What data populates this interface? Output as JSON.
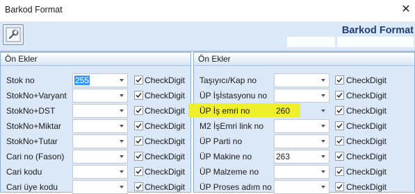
{
  "window": {
    "title": "Barkod Format",
    "close_icon": "close-icon"
  },
  "toolbar": {
    "tool_icon": "wrench-icon"
  },
  "header": {
    "title": "Barkod Format"
  },
  "highlight_color": "#efef2a",
  "selection_color": "#3399ff",
  "left_panel": {
    "title": "Ön Ekler",
    "rows": [
      {
        "label": "Stok no",
        "value": "255",
        "check_label": "CheckDigit",
        "checked": true,
        "selected": true
      },
      {
        "label": "StokNo+Varyant",
        "value": "",
        "check_label": "CheckDigit",
        "checked": true
      },
      {
        "label": "StokNo+DST",
        "value": "",
        "check_label": "CheckDigit",
        "checked": true
      },
      {
        "label": "StokNo+Miktar",
        "value": "",
        "check_label": "CheckDigit",
        "checked": true
      },
      {
        "label": "StokNo+Tutar",
        "value": "",
        "check_label": "CheckDigit",
        "checked": true
      },
      {
        "label": "Cari no (Fason)",
        "value": "",
        "check_label": "CheckDigit",
        "checked": true
      },
      {
        "label": "Cari kodu",
        "value": "",
        "check_label": "CheckDigit",
        "checked": true
      },
      {
        "label": "Cari üye kodu",
        "value": "",
        "check_label": "CheckDigit",
        "checked": true
      }
    ]
  },
  "right_panel": {
    "title": "Ön Ekler",
    "rows": [
      {
        "label": "Taşıyıcı/Kap no",
        "value": "",
        "check_label": "CheckDigit",
        "checked": true
      },
      {
        "label": "ÜP İşİstasyonu no",
        "value": "",
        "check_label": "CheckDigit",
        "checked": true
      },
      {
        "label": "ÜP İş emri no",
        "value": "260",
        "check_label": "CheckDigit",
        "checked": true,
        "highlighted": true
      },
      {
        "label": "M2 İşEmri link no",
        "value": "",
        "check_label": "CheckDigit",
        "checked": true
      },
      {
        "label": "ÜP Parti no",
        "value": "",
        "check_label": "CheckDigit",
        "checked": true
      },
      {
        "label": "ÜP Makine no",
        "value": "263",
        "check_label": "CheckDigit",
        "checked": true
      },
      {
        "label": "ÜP Malzeme no",
        "value": "",
        "check_label": "CheckDigit",
        "checked": true
      },
      {
        "label": "ÜP Proses adım no",
        "value": "",
        "check_label": "CheckDigit",
        "checked": true
      }
    ]
  }
}
